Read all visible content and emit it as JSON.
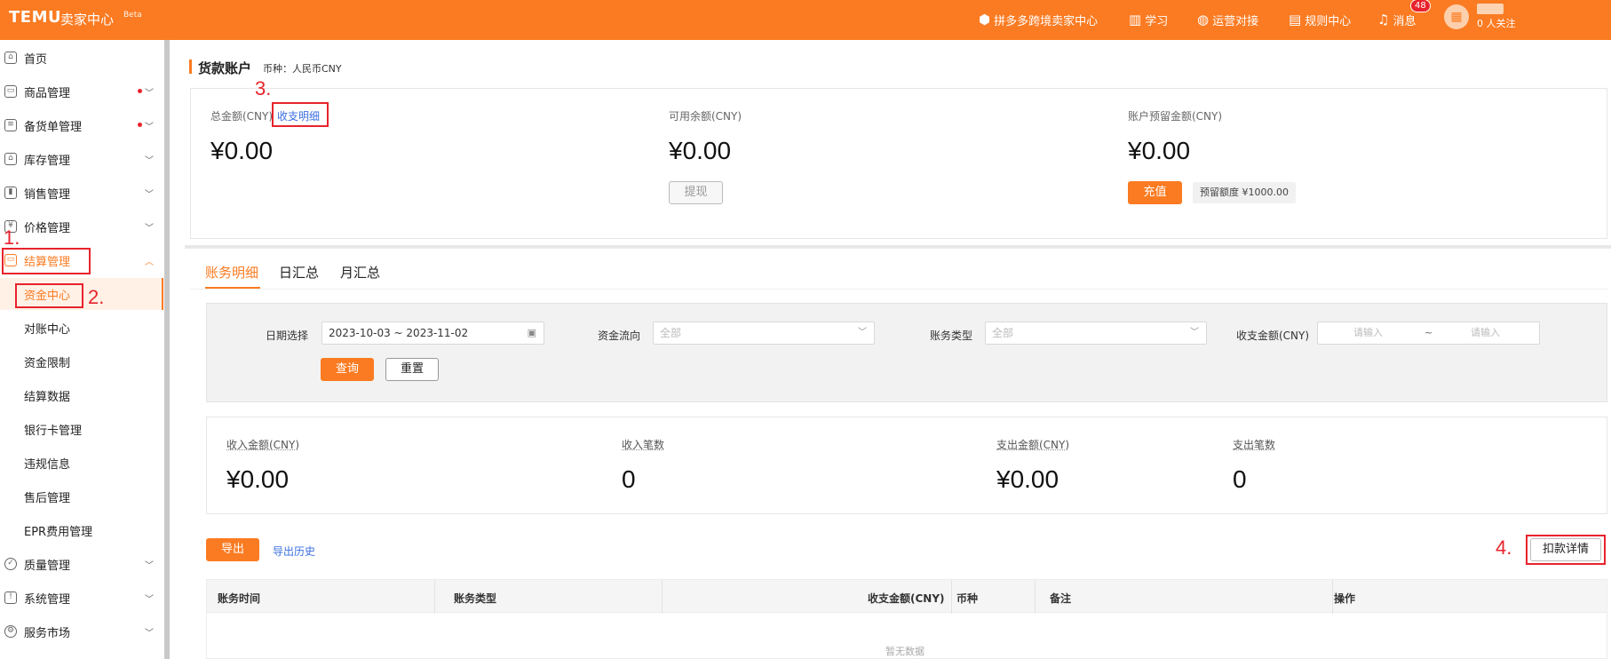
{
  "topbar": {
    "brand": "TEMU",
    "subtitle": "卖家中心",
    "beta": "Beta",
    "nav": [
      {
        "label": "拼多多跨境卖家中心",
        "icon": "cube-icon"
      },
      {
        "label": "学习",
        "icon": "book-icon"
      },
      {
        "label": "运营对接",
        "icon": "chat-icon"
      },
      {
        "label": "规则中心",
        "icon": "document-icon"
      },
      {
        "label": "消息",
        "icon": "bell-icon"
      }
    ],
    "message_count": "48",
    "followers": "0 人关注"
  },
  "sidebar": {
    "items": [
      {
        "label": "首页",
        "icon": "home-icon"
      },
      {
        "label": "商品管理",
        "icon": "product-icon"
      },
      {
        "label": "备货单管理",
        "icon": "order-icon"
      },
      {
        "label": "库存管理",
        "icon": "warehouse-icon"
      },
      {
        "label": "销售管理",
        "icon": "chart-icon"
      },
      {
        "label": "价格管理",
        "icon": "price-icon"
      },
      {
        "label": "结算管理",
        "icon": "wallet-icon"
      }
    ],
    "sub_items": [
      {
        "label": "资金中心"
      },
      {
        "label": "对账中心"
      },
      {
        "label": "资金限制"
      },
      {
        "label": "结算数据"
      },
      {
        "label": "银行卡管理"
      },
      {
        "label": "违规信息"
      },
      {
        "label": "售后管理"
      },
      {
        "label": "EPR费用管理"
      }
    ],
    "bottom_items": [
      {
        "label": "质量管理",
        "icon": "shield-check-icon"
      },
      {
        "label": "系统管理",
        "icon": "shield-icon"
      },
      {
        "label": "服务市场",
        "icon": "gear-icon"
      }
    ]
  },
  "annotations": [
    "1.",
    "2.",
    "3.",
    "4."
  ],
  "account": {
    "title": "货款账户",
    "currency": "币种：人民币CNY",
    "total_label": "总金额(CNY)",
    "detail_link": "收支明细",
    "total_amount": "¥0.00",
    "available_label": "可用余额(CNY)",
    "available_amount": "¥0.00",
    "withdraw_button": "提现",
    "reserve_label": "账户预留金额(CNY)",
    "reserve_amount": "¥0.00",
    "recharge_button": "充值",
    "reserve_quota": "预留额度 ¥1000.00"
  },
  "tabs": [
    "账务明细",
    "日汇总",
    "月汇总"
  ],
  "filters": {
    "date_label": "日期选择",
    "date_value": "2023-10-03 ~ 2023-11-02",
    "flow_label": "资金流向",
    "flow_value": "全部",
    "type_label": "账务类型",
    "type_value": "全部",
    "amount_label": "收支金额(CNY)",
    "amount_min_placeholder": "请输入",
    "amount_separator": "~",
    "amount_max_placeholder": "请输入",
    "query_button": "查询",
    "reset_button": "重置"
  },
  "stats": {
    "income_amount_label": "收入金额(CNY)",
    "income_amount": "¥0.00",
    "income_count_label": "收入笔数",
    "income_count": "0",
    "expense_amount_label": "支出金额(CNY)",
    "expense_amount": "¥0.00",
    "expense_count_label": "支出笔数",
    "expense_count": "0"
  },
  "actions": {
    "export_button": "导出",
    "export_history": "导出历史",
    "deduction_button": "扣款详情"
  },
  "table": {
    "columns": [
      "账务时间",
      "账务类型",
      "收支金额(CNY)",
      "币种",
      "备注",
      "操作"
    ],
    "empty_text": "暂无数据"
  },
  "colors": {
    "brand": "#fb7b22",
    "annotation": "#e8232c",
    "link": "#3a6fe0"
  }
}
